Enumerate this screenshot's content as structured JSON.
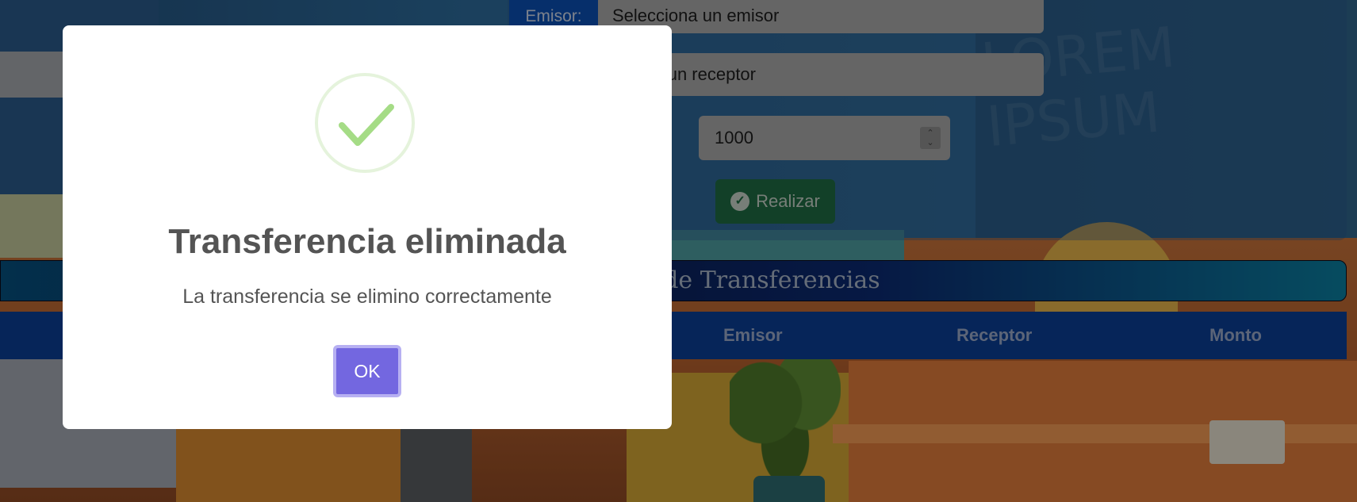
{
  "form": {
    "emisor_label": "Emisor:",
    "emisor_placeholder": "Selecciona un emisor",
    "receptor_placeholder": "cciona un receptor",
    "monto_label_fragment": ":",
    "monto_value": "1000",
    "realizar_label": "Realizar"
  },
  "table": {
    "title": "bla de Transferencias",
    "columns": [
      "Emisor",
      "Receptor",
      "Monto"
    ]
  },
  "background": {
    "board_text": "LOREM IPSUM"
  },
  "modal": {
    "title": "Transferencia eliminada",
    "message": "La transferencia se elimino correctamente",
    "ok_label": "OK",
    "icon": "success-check-icon",
    "accent_color": "#7367e0",
    "success_color": "#a5dc86"
  }
}
